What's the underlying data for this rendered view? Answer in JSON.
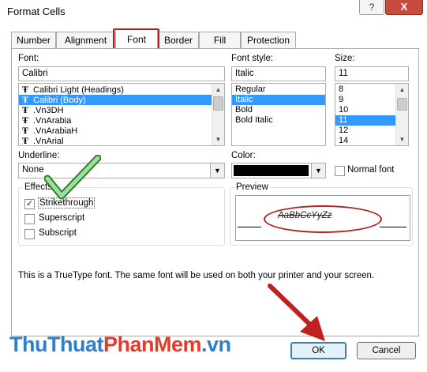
{
  "window": {
    "title": "Format Cells",
    "help_label": "?",
    "close_label": "X"
  },
  "tabs": [
    {
      "label": "Number"
    },
    {
      "label": "Alignment"
    },
    {
      "label": "Font",
      "active": true
    },
    {
      "label": "Border"
    },
    {
      "label": "Fill"
    },
    {
      "label": "Protection"
    }
  ],
  "font": {
    "label": "Font:",
    "value": "Calibri",
    "items": [
      {
        "label": "Calibri Light (Headings)"
      },
      {
        "label": "Calibri (Body)",
        "selected": true
      },
      {
        "label": ".Vn3DH"
      },
      {
        "label": ".VnArabia"
      },
      {
        "label": ".VnArabiaH"
      },
      {
        "label": ".VnArial"
      }
    ]
  },
  "font_style": {
    "label": "Font style:",
    "value": "Italic",
    "items": [
      {
        "label": "Regular"
      },
      {
        "label": "Italic",
        "selected": true
      },
      {
        "label": "Bold"
      },
      {
        "label": "Bold Italic"
      }
    ]
  },
  "size": {
    "label": "Size:",
    "value": "11",
    "items": [
      {
        "label": "8"
      },
      {
        "label": "9"
      },
      {
        "label": "10"
      },
      {
        "label": "11",
        "selected": true
      },
      {
        "label": "12"
      },
      {
        "label": "14"
      }
    ]
  },
  "underline": {
    "label": "Underline:",
    "value": "None"
  },
  "color": {
    "label": "Color:",
    "value": "#000000",
    "normal_font_label": "Normal font"
  },
  "effects": {
    "label": "Effects",
    "strikethrough": {
      "label": "Strikethrough",
      "checked": true
    },
    "superscript": {
      "label": "Superscript",
      "checked": false
    },
    "subscript": {
      "label": "Subscript",
      "checked": false
    }
  },
  "preview": {
    "label": "Preview",
    "sample": "AaBbCcYyZz"
  },
  "info_text": "This is a TrueType font.  The same font will be used on both your printer and your screen.",
  "buttons": {
    "ok": "OK",
    "cancel": "Cancel"
  },
  "watermark": {
    "part1": "ThuThuat",
    "part2": "PhanMem",
    "part3": ".vn"
  },
  "colors": {
    "highlight": "#b51e22",
    "selection": "#3399ff",
    "watermark_blue": "#2f7fc8",
    "watermark_red": "#e23b2c"
  }
}
